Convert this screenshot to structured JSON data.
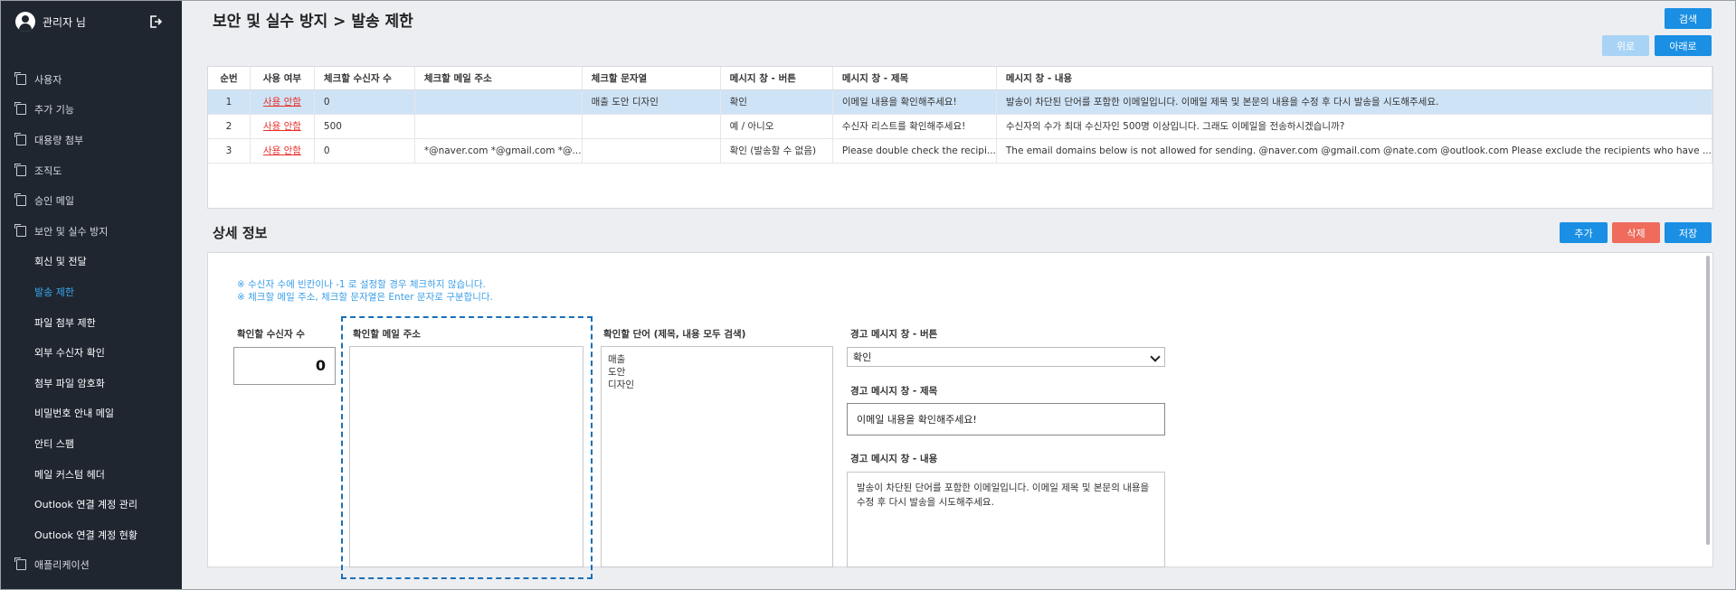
{
  "sidebar": {
    "user_name": "관리자 님",
    "items": [
      {
        "label": "사용자",
        "level": "top"
      },
      {
        "label": "추가 기능",
        "level": "top"
      },
      {
        "label": "대용량 첨부",
        "level": "top"
      },
      {
        "label": "조직도",
        "level": "top"
      },
      {
        "label": "승인 메일",
        "level": "top"
      },
      {
        "label": "보안 및 실수 방지",
        "level": "top"
      },
      {
        "label": "회신 및 전달",
        "level": "sub"
      },
      {
        "label": "발송 제한",
        "level": "sub",
        "active": true
      },
      {
        "label": "파일 첨부 제한",
        "level": "sub"
      },
      {
        "label": "외부 수신자 확인",
        "level": "sub"
      },
      {
        "label": "첨부 파일 암호화",
        "level": "sub"
      },
      {
        "label": "비밀번호 안내 메일",
        "level": "sub"
      },
      {
        "label": "안티 스팸",
        "level": "sub"
      },
      {
        "label": "메일 커스텀 헤더",
        "level": "sub"
      },
      {
        "label": "Outlook 연결 계정 관리",
        "level": "sub"
      },
      {
        "label": "Outlook 연결 계정 현황",
        "level": "sub"
      },
      {
        "label": "애플리케이션",
        "level": "top"
      }
    ]
  },
  "header": {
    "title": "보안 및 실수 방지 > 발송 제한",
    "search_label": "검색",
    "up_label": "위로",
    "down_label": "아래로"
  },
  "table": {
    "columns": [
      "순번",
      "사용 여부",
      "체크할 수신자 수",
      "체크할 메일 주소",
      "체크할 문자열",
      "메시지 창 - 버튼",
      "메시지 창 - 제목",
      "메시지 창 - 내용"
    ],
    "rows": [
      [
        "1",
        "사용 안함",
        "0",
        "",
        "매출 도안 디자인",
        "확인",
        "이메일 내용을 확인해주세요!",
        "발송이 차단된 단어를 포함한 이메일입니다. 이메일 제목 및 본문의 내용을 수정 후 다시 발송을 시도해주세요."
      ],
      [
        "2",
        "사용 안함",
        "500",
        "",
        "",
        "예 / 아니오",
        "수신자 리스트를 확인해주세요!",
        "수신자의 수가 최대 수신자인 500명 이상입니다. 그래도 이메일을 전송하시겠습니까?"
      ],
      [
        "3",
        "사용 안함",
        "0",
        "*@naver.com *@gmail.com *@...",
        "",
        "확인 (발송할 수 없음)",
        "Please double check the recipi...",
        "The email domains below is not allowed for sending. @naver.com @gmail.com @nate.com @outlook.com Please exclude the recipients who have ..."
      ]
    ]
  },
  "detail": {
    "title": "상세 정보",
    "add_label": "추가",
    "delete_label": "삭제",
    "save_label": "저장",
    "notes": [
      "※ 수신자 수에 빈칸이나 -1 로 설정할 경우 체크하지 않습니다.",
      "※ 체크할 메일 주소, 체크할 문자열은 Enter 문자로 구분합니다."
    ],
    "recipient_count_label": "확인할 수신자 수",
    "recipient_count_value": "0",
    "email_label": "확인할 메일 주소",
    "email_value": "",
    "words_label": "확인할 단어 (제목, 내용 모두 검색)",
    "words": [
      "매출",
      "도안",
      "디자인"
    ],
    "button_label": "경고 메시지 창 - 버튼",
    "button_value": "확인",
    "msg_title_label": "경고 메시지 창 - 제목",
    "msg_title_value": "이메일 내용을 확인해주세요!",
    "msg_content_label": "경고 메시지 창 - 내용",
    "msg_content_value": "발송이 차단된 단어를 포함한 이메일입니다. 이메일 제목 및 본문의 내용을 수정 후 다시 발송을 시도해주세요."
  },
  "colors": {
    "sidebar_bg": "#1f2630",
    "accent_blue": "#1a8fe3",
    "active_menu": "#37a6ee",
    "delete_red": "#ef6b5b",
    "selected_row": "#cfe3f6",
    "link_red": "#e8312b"
  }
}
